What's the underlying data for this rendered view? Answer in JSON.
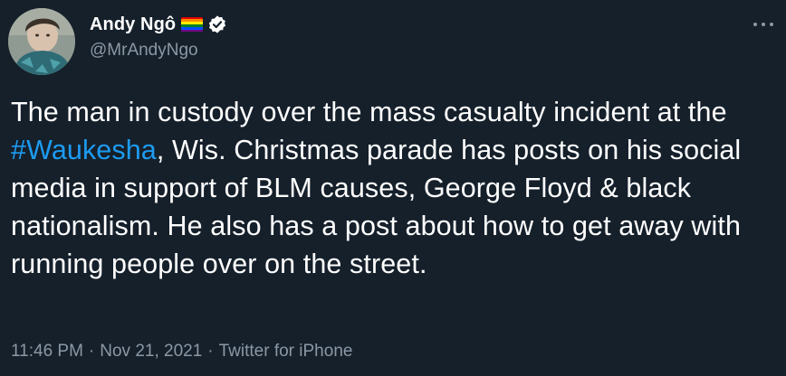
{
  "author": {
    "display_name": "Andy Ngô",
    "handle": "@MrAndyNgo",
    "badges": [
      "rainbow-flag-emoji",
      "verified-badge-icon"
    ]
  },
  "tweet": {
    "text_before_hashtag": "The man in custody over the mass casualty incident at the ",
    "hashtag": "#Waukesha",
    "text_after_hashtag": ", Wis. Christmas parade has posts on his social media in support of BLM causes, George Floyd & black nationalism. He also has a post about how to get away with running people over on the street.",
    "time": "11:46 PM",
    "date": "Nov 21, 2021",
    "source": "Twitter for iPhone",
    "separator": "·"
  },
  "colors": {
    "background": "#15202b",
    "text": "#ffffff",
    "secondary": "#8b98a5",
    "link": "#1d9bf0"
  },
  "icons": {
    "more": "more-horizontal-icon"
  }
}
